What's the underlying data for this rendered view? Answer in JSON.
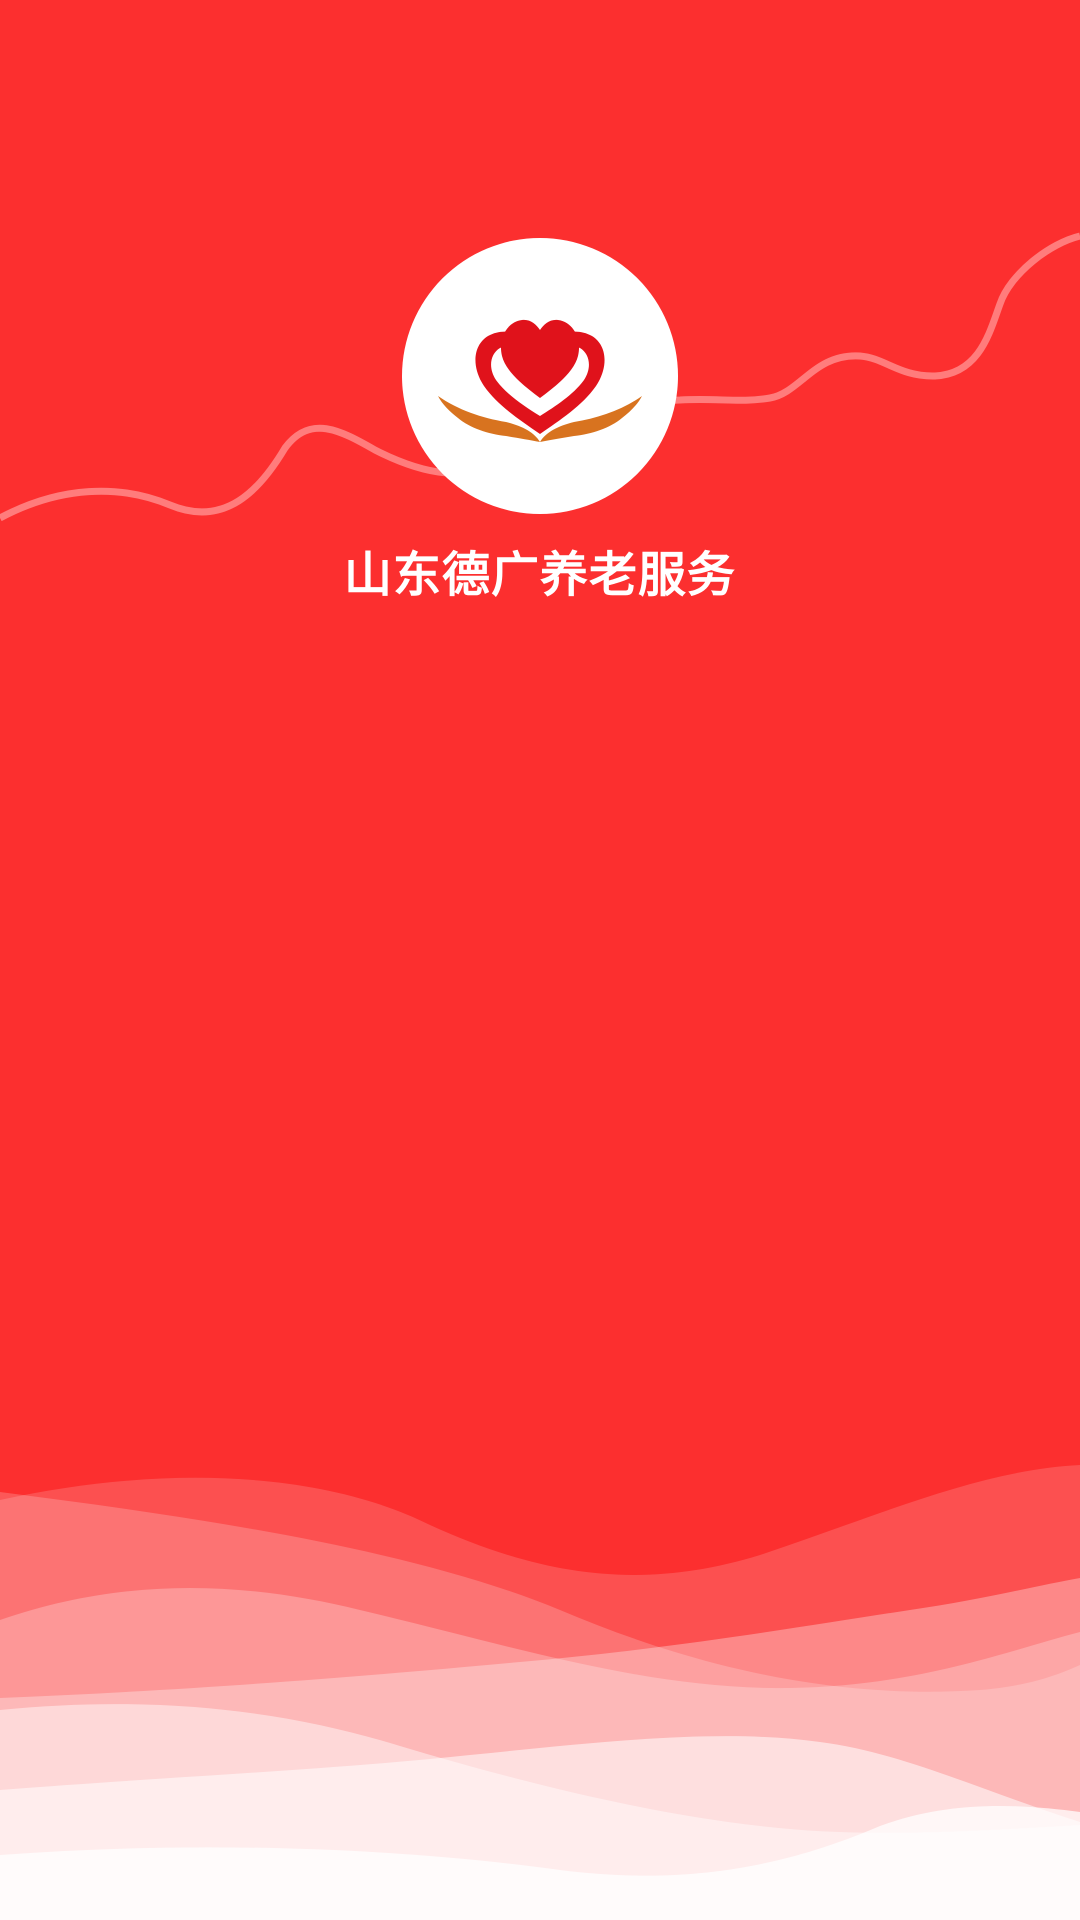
{
  "app": {
    "title": "山东德广养老服务"
  },
  "colors": {
    "background": "#FC2F2F",
    "logo_heart": "#E0121B",
    "logo_hands": "#D8731F",
    "logo_circle": "#FFFFFF"
  },
  "icons": {
    "logo": "heart-in-hands-logo"
  }
}
